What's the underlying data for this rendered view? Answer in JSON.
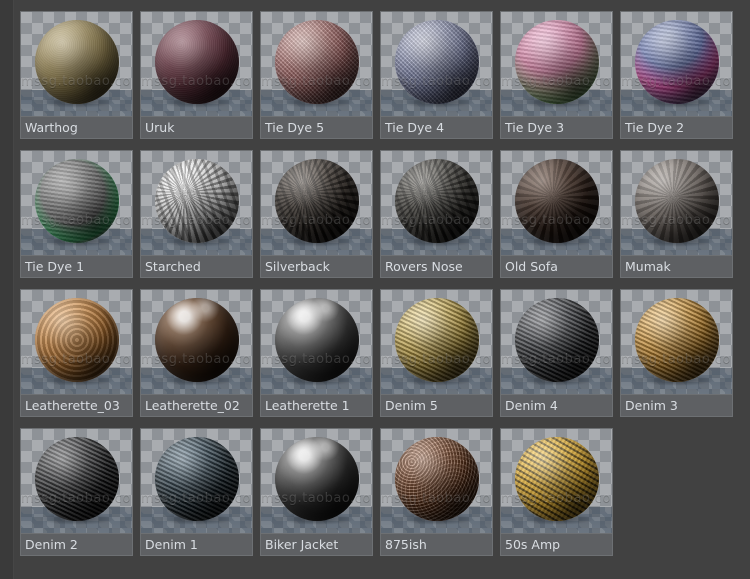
{
  "window": {
    "background_color": "#414141",
    "tile_background_color": "#5b5d60",
    "label_background_color": "#5e6063",
    "label_text_color": "#d9dde2",
    "watermark": "mssg.taobao.com"
  },
  "grid": {
    "columns": 6,
    "rows": 4,
    "total_items": 23
  },
  "materials": [
    {
      "label": "Warthog",
      "base": "#8a7a4e",
      "tex": "tex-noise",
      "sphere_gradient": "radial-gradient(circle at 35% 28%, #b9a877, #8d7c4d 45%, #4e4427 88%)"
    },
    {
      "label": "Uruk",
      "base": "#5c2f38",
      "tex": "tex-noise",
      "sphere_gradient": "radial-gradient(circle at 38% 26%, #8d5663, #5e303b 48%, #2c161c 90%)"
    },
    {
      "label": "Tie Dye 5",
      "base": "#b86a6a",
      "tex": "tex-weave",
      "sphere_gradient": "radial-gradient(circle at 36% 26%, #e0a8a0, #b56b6a 45%, #5c3634 90%)"
    },
    {
      "label": "Tie Dye 4",
      "base": "#8f96c4",
      "tex": "tex-weave",
      "sphere_gradient": "radial-gradient(circle at 38% 24%, #c9cee8, #8e96c2 45%, #4a4f76 90%)"
    },
    {
      "label": "Tie Dye 3",
      "base": "#d77fae",
      "tex": "tex-tiedye",
      "sphere_gradient": "radial-gradient(circle at 40% 22%, #f0a9cd, #d4799f 40%, #6d9c5e 78%, #3f5c34 95%)"
    },
    {
      "label": "Tie Dye 2",
      "base": "#6b7fc0",
      "tex": "tex-tiedye",
      "sphere_gradient": "radial-gradient(circle at 42% 18%, #9aa6c9, #5f6fae 38%, #d0469a 62%, #3d4a72 92%)"
    },
    {
      "label": "Tie Dye 1",
      "base": "#7d7d7d",
      "tex": "tex-tiedye",
      "sphere_gradient": "radial-gradient(circle at 45% 40%, #9a9a9a, #6a6a6a 46%, #36c06a 70%, #e24fa8 86%, #2b2b2b 98%)"
    },
    {
      "label": "Starched",
      "base": "#d8d8d8",
      "tex": "tex-crack",
      "sphere_gradient": "radial-gradient(circle at 36% 26%, #ffffff, #dcdcdc 45%, #8e8e8e 92%)"
    },
    {
      "label": "Silverback",
      "base": "#2d2722",
      "tex": "tex-crack",
      "sphere_gradient": "radial-gradient(circle at 38% 24%, #5c5046, #322b25 48%, #120f0d 92%)"
    },
    {
      "label": "Rovers Nose",
      "base": "#3b3a36",
      "tex": "tex-crack",
      "sphere_gradient": "radial-gradient(circle at 36% 26%, #6d6a62, #3d3b36 48%, #171614 92%)"
    },
    {
      "label": "Old Sofa",
      "base": "#2b1b14",
      "tex": "tex-rough",
      "sphere_gradient": "radial-gradient(circle at 36% 26%, #5a3c2c, #2e1e16 48%, #100a07 92%)"
    },
    {
      "label": "Mumak",
      "base": "#6e655f",
      "tex": "tex-rough",
      "sphere_gradient": "radial-gradient(circle at 36% 26%, #9c938c, #6d645e 48%, #332e2a 92%)"
    },
    {
      "label": "Leatherette_03",
      "base": "#c07a30",
      "tex": "tex-bump",
      "sphere_gradient": "radial-gradient(circle at 36% 26%, #e8a257, #c47c33 45%, #633c15 92%)"
    },
    {
      "label": "Leatherette_02",
      "base": "#3a2418",
      "tex": "tex-gloss",
      "sphere_gradient": "radial-gradient(circle at 36% 24%, #8a5b36, #3d2718 50%, #150d07 92%)"
    },
    {
      "label": "Leatherette 1",
      "base": "#3a3a3a",
      "tex": "tex-gloss",
      "sphere_gradient": "radial-gradient(circle at 36% 22%, #a9a9a9, #3f3f3f 50%, #121212 92%)"
    },
    {
      "label": "Denim 5",
      "base": "#c8a43a",
      "tex": "tex-knit",
      "sphere_gradient": "radial-gradient(circle at 36% 26%, #efd379, #c6a338 45%, #6a5416 92%)"
    },
    {
      "label": "Denim 4",
      "base": "#24262a",
      "tex": "tex-knit",
      "sphere_gradient": "radial-gradient(circle at 36% 26%, #51545c, #26282c 48%, #0d0e10 92%)"
    },
    {
      "label": "Denim 3",
      "base": "#d08b20",
      "tex": "tex-knit",
      "sphere_gradient": "radial-gradient(circle at 36% 26%, #f0b450, #cf8a1f 45%, #6c470c 92%)"
    },
    {
      "label": "Denim 2",
      "base": "#1a1a1c",
      "tex": "tex-knit",
      "sphere_gradient": "radial-gradient(circle at 36% 26%, #45464a, #1c1d1f 48%, #08080a 92%)"
    },
    {
      "label": "Denim 1",
      "base": "#16242e",
      "tex": "tex-knit",
      "sphere_gradient": "radial-gradient(circle at 36% 26%, #3c5c72, #17262f 50%, #070d11 92%)"
    },
    {
      "label": "Biker Jacket",
      "base": "#2c2c2c",
      "tex": "tex-gloss",
      "sphere_gradient": "radial-gradient(circle at 36% 22%, #9b9b9b, #313131 50%, #0c0c0c 92%)"
    },
    {
      "label": "875ish",
      "base": "#8c4a22",
      "tex": "tex-speck",
      "sphere_gradient": "radial-gradient(circle at 34% 24%, #c17043, #8d4a22 48%, #3d1f0c 92%)"
    },
    {
      "label": "50s Amp",
      "base": "#d9a227",
      "tex": "tex-dot",
      "sphere_gradient": "radial-gradient(circle at 36% 26%, #f5cd63, #d7a127 45%, #6f5110 92%)"
    }
  ]
}
